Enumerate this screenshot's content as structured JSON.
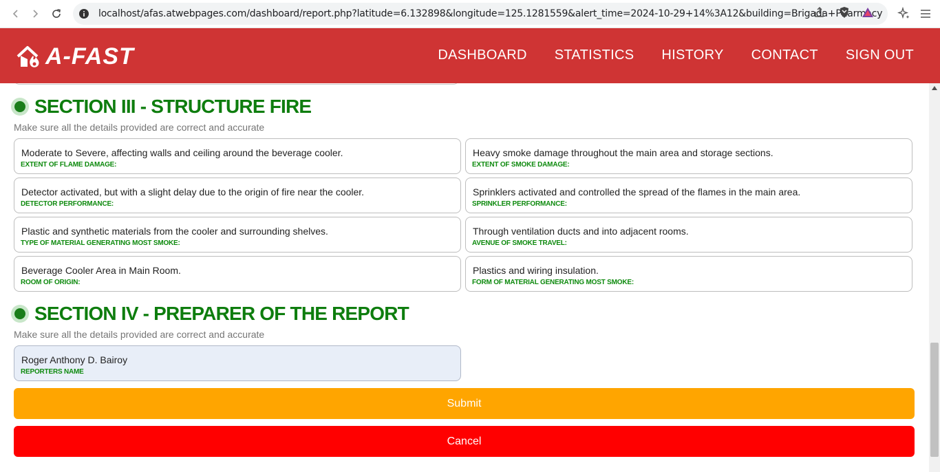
{
  "browser": {
    "url": "localhost/afas.atwebpages.com/dashboard/report.php?latitude=6.132898&longitude=125.1281559&alert_time=2024-10-29+14%3A12&building=Brigada+Pharmacy"
  },
  "header": {
    "logo_text": "A-FAST",
    "nav": [
      "DASHBOARD",
      "STATISTICS",
      "HISTORY",
      "CONTACT",
      "SIGN OUT"
    ]
  },
  "section3": {
    "title": "SECTION III - STRUCTURE FIRE",
    "subtitle": "Make sure all the details provided are correct and accurate",
    "fields": [
      {
        "value": "Moderate to Severe, affecting walls and ceiling around the beverage cooler.",
        "label": "EXTENT OF FLAME DAMAGE:"
      },
      {
        "value": "Heavy smoke damage throughout the main area and storage sections.",
        "label": "EXTENT OF SMOKE DAMAGE:"
      },
      {
        "value": "Detector activated, but with a slight delay due to the origin of fire near the cooler.",
        "label": "DETECTOR PERFORMANCE:"
      },
      {
        "value": "Sprinklers activated and controlled the spread of the flames in the main area.",
        "label": "SPRINKLER PERFORMANCE:"
      },
      {
        "value": "Plastic and synthetic materials from the cooler and surrounding shelves.",
        "label": "TYPE OF MATERIAL GENERATING MOST SMOKE:"
      },
      {
        "value": "Through ventilation ducts and into adjacent rooms.",
        "label": "AVENUE OF SMOKE TRAVEL:"
      },
      {
        "value": "Beverage Cooler Area in Main Room.",
        "label": "ROOM OF ORIGIN:"
      },
      {
        "value": "Plastics and wiring insulation.",
        "label": "FORM OF MATERIAL GENERATING MOST SMOKE:"
      }
    ]
  },
  "section4": {
    "title": "SECTION IV - PREPARER OF THE REPORT",
    "subtitle": "Make sure all the details provided are correct and accurate",
    "reporter": {
      "value": "Roger Anthony D. Bairoy",
      "label": "REPORTERS NAME"
    }
  },
  "buttons": {
    "submit": "Submit",
    "cancel": "Cancel"
  },
  "colors": {
    "header_bg": "#cf3434",
    "section_green": "#0e7d0e",
    "submit_bg": "#ffa500",
    "cancel_bg": "#ff0000"
  }
}
